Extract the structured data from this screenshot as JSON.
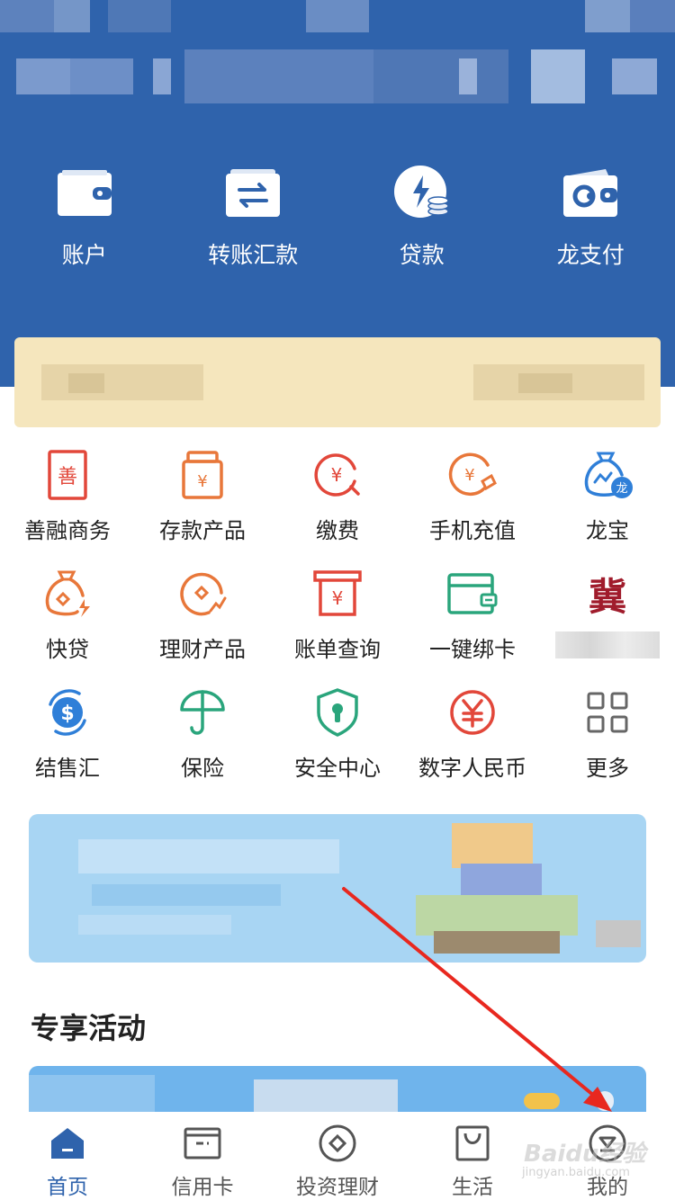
{
  "quick_actions": [
    {
      "label": "账户",
      "icon": "wallet-icon"
    },
    {
      "label": "转账汇款",
      "icon": "transfer-icon"
    },
    {
      "label": "贷款",
      "icon": "loan-icon"
    },
    {
      "label": "龙支付",
      "icon": "long-pay-icon"
    }
  ],
  "services": [
    [
      {
        "label": "善融商务",
        "icon": "shan-icon"
      },
      {
        "label": "存款产品",
        "icon": "deposit-icon"
      },
      {
        "label": "缴费",
        "icon": "payment-icon"
      },
      {
        "label": "手机充值",
        "icon": "phone-recharge-icon"
      },
      {
        "label": "龙宝",
        "icon": "long-bao-icon"
      }
    ],
    [
      {
        "label": "快贷",
        "icon": "quick-loan-icon"
      },
      {
        "label": "理财产品",
        "icon": "wealth-icon"
      },
      {
        "label": "账单查询",
        "icon": "bill-icon"
      },
      {
        "label": "一键绑卡",
        "icon": "bind-card-icon"
      },
      {
        "label": "",
        "icon": "ji-icon",
        "glyph": "冀"
      }
    ],
    [
      {
        "label": "结售汇",
        "icon": "fx-icon"
      },
      {
        "label": "保险",
        "icon": "insurance-icon"
      },
      {
        "label": "安全中心",
        "icon": "security-icon"
      },
      {
        "label": "数字人民币",
        "icon": "e-cny-icon"
      },
      {
        "label": "更多",
        "icon": "more-icon"
      }
    ]
  ],
  "section": {
    "title": "专享活动"
  },
  "bottom_nav": [
    {
      "label": "首页",
      "icon": "home-icon",
      "active": true
    },
    {
      "label": "信用卡",
      "icon": "credit-card-icon",
      "active": false
    },
    {
      "label": "投资理财",
      "icon": "invest-icon",
      "active": false
    },
    {
      "label": "生活",
      "icon": "life-bag-icon",
      "active": false
    },
    {
      "label": "我的",
      "icon": "profile-icon",
      "active": false
    }
  ],
  "watermark": {
    "text": "Baidu经验",
    "sub": "jingyan.baidu.com"
  },
  "colors": {
    "header_blue": "#2f63ac",
    "accent_red": "#e2473a",
    "accent_orange": "#e8773a",
    "accent_blue": "#2f7fd8",
    "accent_green": "#2aa57c",
    "arrow_red": "#e8281f"
  }
}
